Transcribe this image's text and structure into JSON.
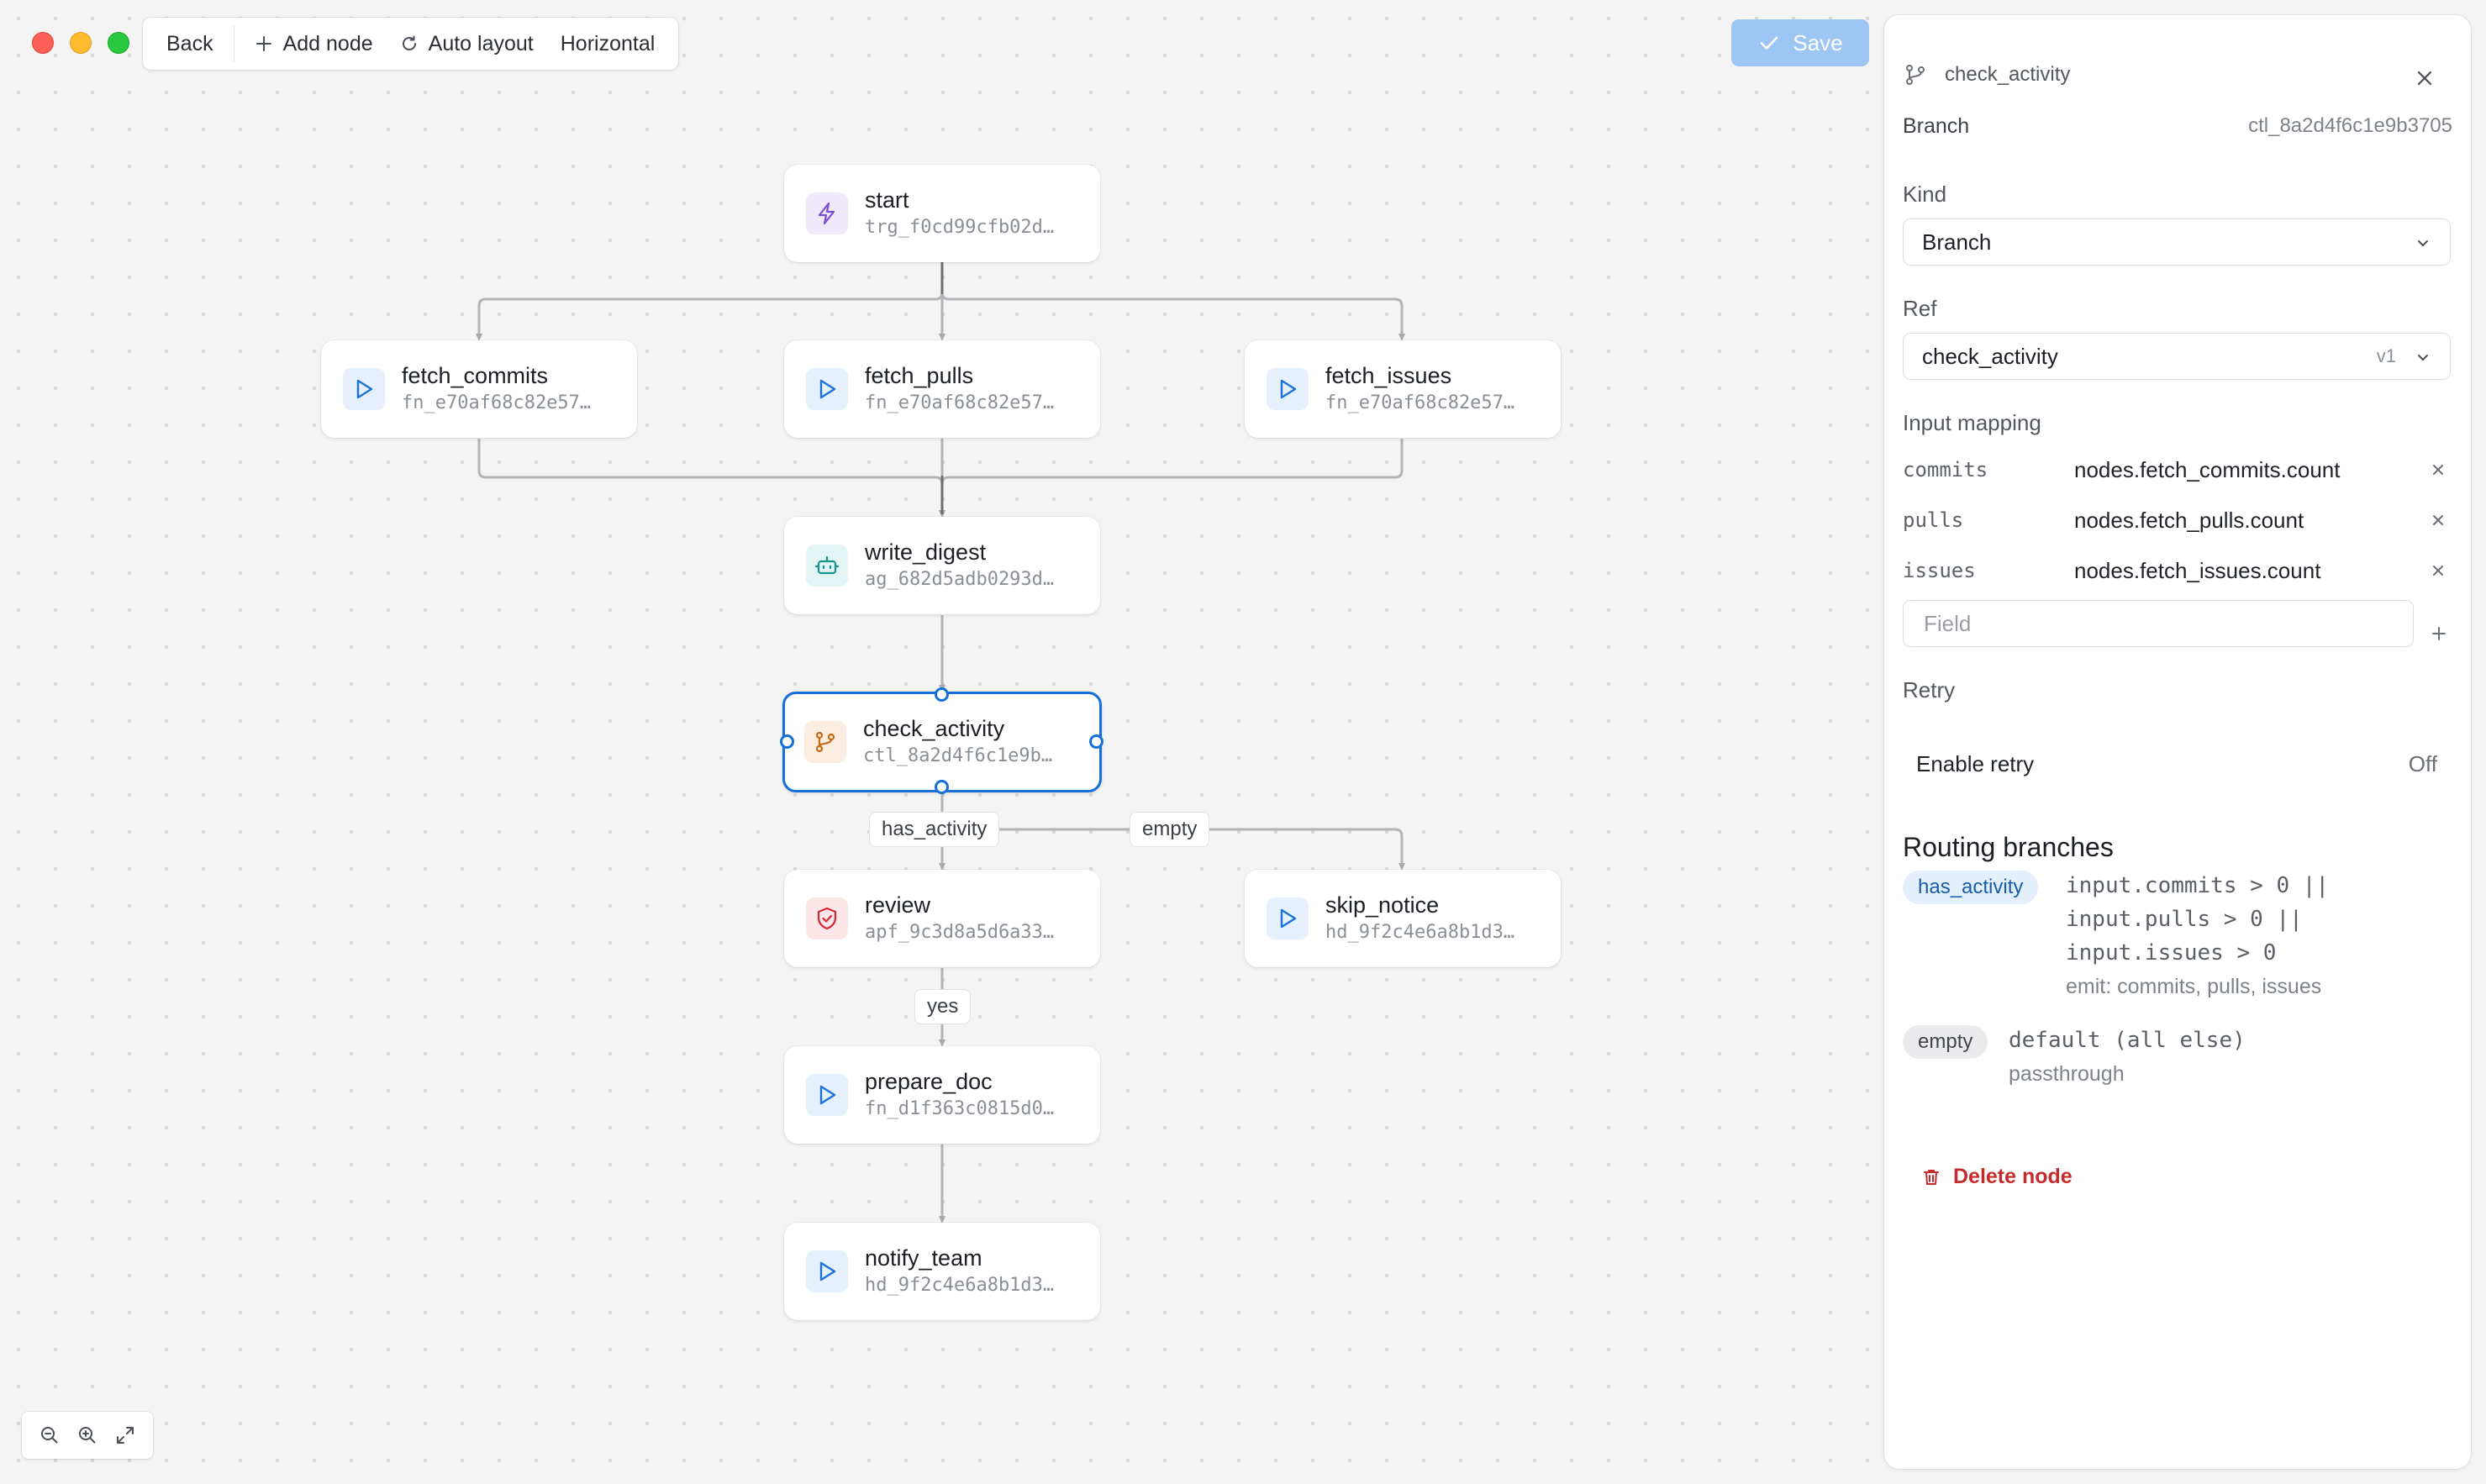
{
  "toolbar": {
    "back": "Back",
    "add_node": "Add node",
    "auto_layout": "Auto layout",
    "orientation": "Horizontal"
  },
  "save_label": "Save",
  "nodes": {
    "start": {
      "name": "start",
      "id": "trg_f0cd99cfb02d…",
      "icon": "lightning-icon"
    },
    "fetch_commits": {
      "name": "fetch_commits",
      "id": "fn_e70af68c82e57…",
      "icon": "play-icon"
    },
    "fetch_pulls": {
      "name": "fetch_pulls",
      "id": "fn_e70af68c82e57…",
      "icon": "play-icon"
    },
    "fetch_issues": {
      "name": "fetch_issues",
      "id": "fn_e70af68c82e57…",
      "icon": "play-icon"
    },
    "write_digest": {
      "name": "write_digest",
      "id": "ag_682d5adb0293d…",
      "icon": "robot-icon"
    },
    "check_activity": {
      "name": "check_activity",
      "id": "ctl_8a2d4f6c1e9b…",
      "icon": "branch-icon"
    },
    "review": {
      "name": "review",
      "id": "apf_9c3d8a5d6a33…",
      "icon": "shield-icon"
    },
    "skip_notice": {
      "name": "skip_notice",
      "id": "hd_9f2c4e6a8b1d3…",
      "icon": "play-icon"
    },
    "prepare_doc": {
      "name": "prepare_doc",
      "id": "fn_d1f363c0815d0…",
      "icon": "play-icon"
    },
    "notify_team": {
      "name": "notify_team",
      "id": "hd_9f2c4e6a8b1d3…",
      "icon": "play-icon"
    }
  },
  "edge_labels": {
    "has_activity": "has_activity",
    "empty": "empty",
    "yes": "yes"
  },
  "panel": {
    "title": "check_activity",
    "type_label": "Branch",
    "ref_id": "ctl_8a2d4f6c1e9b3705",
    "kind_label": "Kind",
    "kind_value": "Branch",
    "ref_label": "Ref",
    "ref_value": "check_activity",
    "ref_version": "v1",
    "input_mapping_label": "Input mapping",
    "mappings": [
      {
        "key": "commits",
        "value": "nodes.fetch_commits.count"
      },
      {
        "key": "pulls",
        "value": "nodes.fetch_pulls.count"
      },
      {
        "key": "issues",
        "value": "nodes.fetch_issues.count"
      }
    ],
    "field_placeholder": "Field",
    "retry_label": "Retry",
    "enable_retry": "Enable retry",
    "retry_state": "Off",
    "routing_heading": "Routing branches",
    "branches": [
      {
        "name": "has_activity",
        "lines": [
          "input.commits > 0 ||",
          "input.pulls > 0 ||",
          "input.issues > 0"
        ],
        "emit": "emit: commits, pulls, issues"
      },
      {
        "name": "empty",
        "lines": [
          "default (all else)"
        ],
        "emit": "passthrough"
      }
    ],
    "delete_label": "Delete node"
  },
  "colors": {
    "accent": "#1570d6",
    "save_bg": "#9dc6f4",
    "danger": "#c62b2b"
  }
}
